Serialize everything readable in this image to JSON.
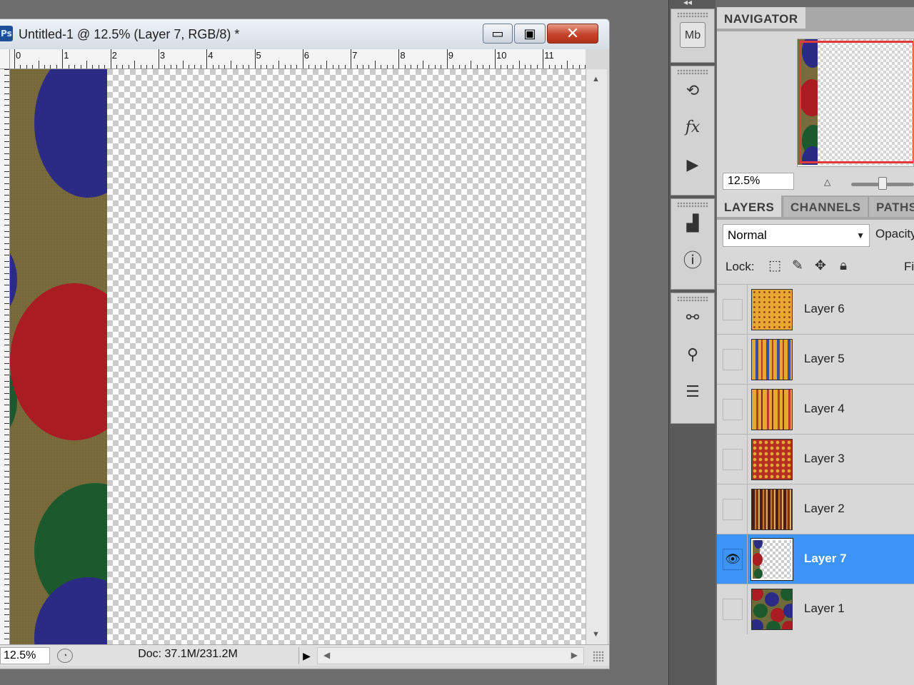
{
  "document": {
    "title": "Untitled-1 @ 12.5% (Layer 7, RGB/8) *",
    "app_icon": "Ps",
    "window_buttons": {
      "minimize": "▭",
      "restore": "▣",
      "close": "✕"
    },
    "ruler_labels": [
      "0",
      "1",
      "2",
      "3",
      "4",
      "5",
      "6",
      "7",
      "8",
      "9",
      "10",
      "11"
    ],
    "status": {
      "zoom": "12.5%",
      "doc_size": "Doc: 37.1M/231.2M",
      "menu_arrow": "▶"
    }
  },
  "dock": {
    "icons": [
      "mini-bridge-icon",
      "history-icon",
      "styles-icon",
      "actions-icon",
      "histogram-icon",
      "info-icon",
      "brushes-icon",
      "clone-source-icon",
      "tool-presets-icon"
    ],
    "mini_bridge_label": "Mb",
    "fx_label": "fx"
  },
  "navigator": {
    "tab": "NAVIGATOR",
    "zoom": "12.5%",
    "view_box_color": "#e23a3a"
  },
  "layers_panel": {
    "tabs": [
      "LAYERS",
      "CHANNELS",
      "PATHS"
    ],
    "blend_mode": "Normal",
    "opacity_label": "Opacity:",
    "lock_label": "Lock:",
    "fill_label": "Fill:",
    "layers": [
      {
        "name": "Layer 6",
        "visible": false,
        "selected": false,
        "thumb": "orange-speckle"
      },
      {
        "name": "Layer 5",
        "visible": false,
        "selected": false,
        "thumb": "blue-stripes"
      },
      {
        "name": "Layer 4",
        "visible": false,
        "selected": false,
        "thumb": "red-stripes"
      },
      {
        "name": "Layer 3",
        "visible": false,
        "selected": false,
        "thumb": "diamonds"
      },
      {
        "name": "Layer 2",
        "visible": false,
        "selected": false,
        "thumb": "brown-stripes"
      },
      {
        "name": "Layer 7",
        "visible": true,
        "selected": true,
        "thumb": "transparent-with-dots"
      },
      {
        "name": "Layer 1",
        "visible": false,
        "selected": false,
        "thumb": "polka-dots"
      }
    ],
    "selected_color": "#3d94f6"
  },
  "colors": {
    "strip_background": "#7a6b3c",
    "dot_blue": "#2b2b86",
    "dot_red": "#a81c22",
    "dot_green": "#1c5a2e"
  }
}
